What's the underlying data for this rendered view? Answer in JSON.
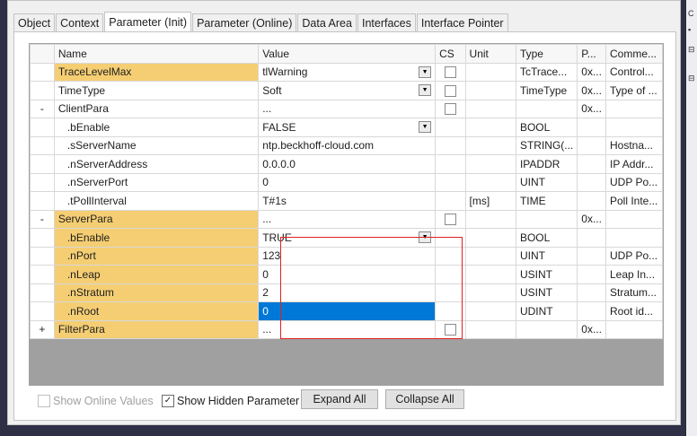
{
  "tabs": [
    "Object",
    "Context",
    "Parameter (Init)",
    "Parameter (Online)",
    "Data Area",
    "Interfaces",
    "Interface Pointer"
  ],
  "active_tab": "Parameter (Init)",
  "columns": {
    "name": "Name",
    "value": "Value",
    "cs": "CS",
    "unit": "Unit",
    "type": "Type",
    "p": "P...",
    "comment": "Comme..."
  },
  "rows": [
    {
      "expander": "",
      "name": "TraceLevelMax",
      "value": "tlWarning",
      "unit": "",
      "type": "TcTrace...",
      "p": "0x...",
      "comment": "Control...",
      "dropdown": true,
      "cs": true,
      "hl": true,
      "depth": 0
    },
    {
      "expander": "",
      "name": "TimeType",
      "value": "Soft",
      "unit": "",
      "type": "TimeType",
      "p": "0x...",
      "comment": "Type of ...",
      "dropdown": true,
      "cs": true,
      "hl": false,
      "depth": 0
    },
    {
      "expander": "-",
      "name": "ClientPara",
      "value": "...",
      "unit": "",
      "type": "",
      "p": "0x...",
      "comment": "",
      "dropdown": false,
      "cs": true,
      "hl": false,
      "depth": 0
    },
    {
      "expander": "",
      "name": ".bEnable",
      "value": "FALSE",
      "unit": "",
      "type": "BOOL",
      "p": "",
      "comment": "",
      "dropdown": true,
      "cs": false,
      "hl": false,
      "depth": 1
    },
    {
      "expander": "",
      "name": ".sServerName",
      "value": "ntp.beckhoff-cloud.com",
      "unit": "",
      "type": "STRING(...",
      "p": "",
      "comment": "Hostna...",
      "dropdown": false,
      "cs": false,
      "hl": false,
      "depth": 1
    },
    {
      "expander": "",
      "name": ".nServerAddress",
      "value": "0.0.0.0",
      "unit": "",
      "type": "IPADDR",
      "p": "",
      "comment": "IP Addr...",
      "dropdown": false,
      "cs": false,
      "hl": false,
      "depth": 1
    },
    {
      "expander": "",
      "name": ".nServerPort",
      "value": "0",
      "unit": "",
      "type": "UINT",
      "p": "",
      "comment": "UDP Po...",
      "dropdown": false,
      "cs": false,
      "hl": false,
      "depth": 1
    },
    {
      "expander": "",
      "name": ".tPollInterval",
      "value": "T#1s",
      "unit": "[ms]",
      "type": "TIME",
      "p": "",
      "comment": "Poll Inte...",
      "dropdown": false,
      "cs": false,
      "hl": false,
      "depth": 1
    },
    {
      "expander": "-",
      "name": "ServerPara",
      "value": "...",
      "unit": "",
      "type": "",
      "p": "0x...",
      "comment": "",
      "dropdown": false,
      "cs": true,
      "hl": true,
      "depth": 0
    },
    {
      "expander": "",
      "name": ".bEnable",
      "value": "TRUE",
      "unit": "",
      "type": "BOOL",
      "p": "",
      "comment": "",
      "dropdown": true,
      "cs": false,
      "hl": true,
      "depth": 1
    },
    {
      "expander": "",
      "name": ".nPort",
      "value": "123",
      "unit": "",
      "type": "UINT",
      "p": "",
      "comment": "UDP Po...",
      "dropdown": false,
      "cs": false,
      "hl": true,
      "depth": 1
    },
    {
      "expander": "",
      "name": ".nLeap",
      "value": "0",
      "unit": "",
      "type": "USINT",
      "p": "",
      "comment": "Leap In...",
      "dropdown": false,
      "cs": false,
      "hl": true,
      "depth": 1
    },
    {
      "expander": "",
      "name": ".nStratum",
      "value": "2",
      "unit": "",
      "type": "USINT",
      "p": "",
      "comment": "Stratum...",
      "dropdown": false,
      "cs": false,
      "hl": true,
      "depth": 1
    },
    {
      "expander": "",
      "name": ".nRoot",
      "value": "0",
      "unit": "",
      "type": "UDINT",
      "p": "",
      "comment": "Root id...",
      "dropdown": false,
      "cs": false,
      "hl": true,
      "depth": 1,
      "selected": true
    },
    {
      "expander": "+",
      "name": "FilterPara",
      "value": "...",
      "unit": "",
      "type": "",
      "p": "0x...",
      "comment": "",
      "dropdown": false,
      "cs": true,
      "hl": true,
      "depth": 0
    }
  ],
  "bottom": {
    "show_online_values": "Show Online Values",
    "show_hidden_parameter": "Show Hidden Parameter",
    "expand_all": "Expand All",
    "collapse_all": "Collapse All"
  },
  "colors": {
    "highlight": "#f5ce73",
    "selection": "#0078d7",
    "annotation": "#e02020"
  }
}
